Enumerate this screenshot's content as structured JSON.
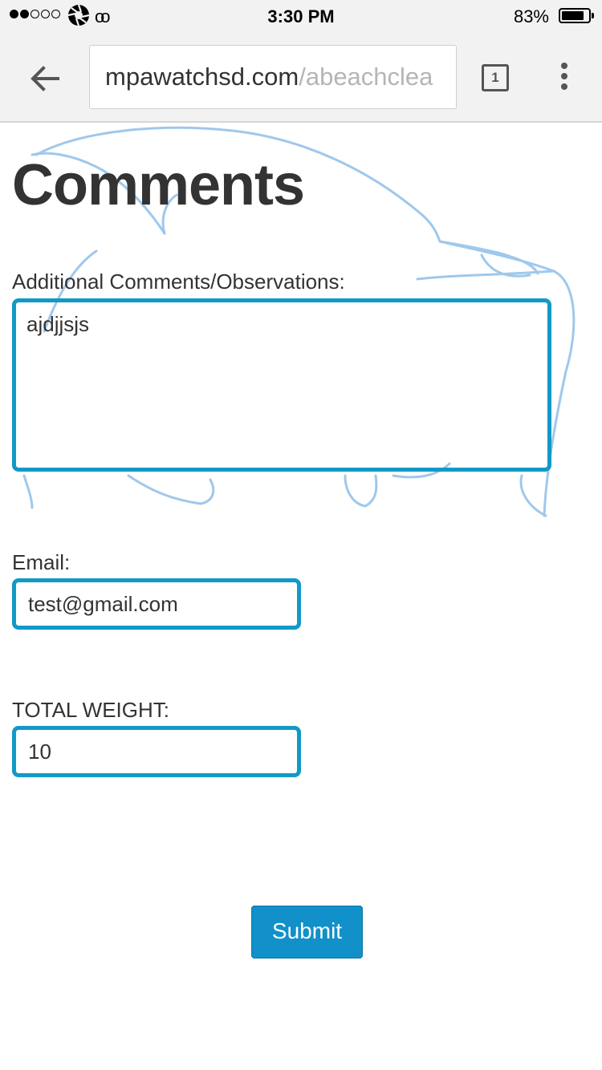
{
  "status_bar": {
    "time": "3:30 PM",
    "battery_percent": "83%",
    "battery_level": 0.83,
    "carrier_icon": "carrier-aperture-icon",
    "signal_icon": "signal-dots-icon"
  },
  "browser": {
    "url_host": "mpawatchsd.com",
    "url_path": "/abeachclea",
    "tab_count": "1",
    "back_icon": "back-arrow-icon",
    "menu_icon": "more-vert-icon"
  },
  "page": {
    "title": "Comments",
    "comments_label": "Additional Comments/Observations:",
    "comments_value": "ajdjjsjs",
    "email_label": "Email:",
    "email_value": "test@gmail.com",
    "weight_label": "TOTAL WEIGHT:",
    "weight_value": "10",
    "submit_label": "Submit"
  },
  "colors": {
    "accent": "#1299c6",
    "button": "#1190c9",
    "watermark": "#9fc8ec"
  }
}
